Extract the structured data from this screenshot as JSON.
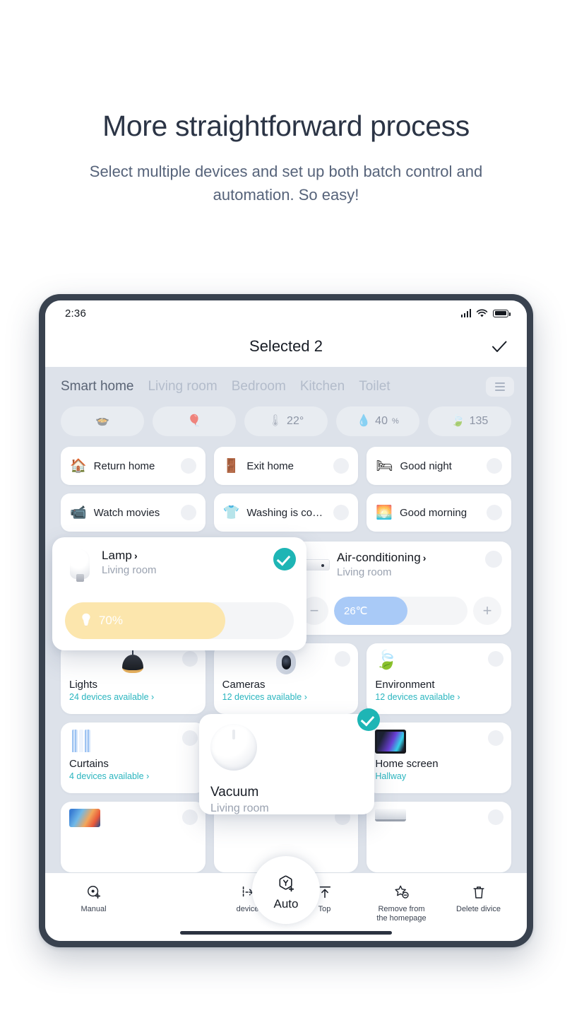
{
  "promo": {
    "title": "More straightforward process",
    "subtitle": "Select multiple devices and set up both batch control and automation. So easy!"
  },
  "status_bar": {
    "time": "2:36"
  },
  "nav": {
    "title": "Selected 2",
    "confirm_icon": "check-icon"
  },
  "room_tabs": [
    {
      "label": "Smart home",
      "active": true
    },
    {
      "label": "Living room",
      "active": false
    },
    {
      "label": "Bedroom",
      "active": false
    },
    {
      "label": "Kitchen",
      "active": false
    },
    {
      "label": "Toilet",
      "active": false
    }
  ],
  "sensor_chips": [
    {
      "icon": "cooking-pot-icon",
      "glyph": "🍲",
      "value": ""
    },
    {
      "icon": "balloon-icon",
      "glyph": "🎈",
      "value": ""
    },
    {
      "icon": "thermometer-icon",
      "glyph": "🌡",
      "value": "22°"
    },
    {
      "icon": "humidity-drop-icon",
      "glyph": "💧",
      "value": "40",
      "unit": "%"
    },
    {
      "icon": "leaf-icon",
      "glyph": "🍃",
      "value": "135"
    }
  ],
  "scenes": [
    {
      "label": "Return home",
      "icon": "house-icon",
      "glyph": "🏠"
    },
    {
      "label": "Exit home",
      "icon": "door-icon",
      "glyph": "🚪"
    },
    {
      "label": "Good night",
      "icon": "bed-icon",
      "glyph": "🛏"
    },
    {
      "label": "Watch movies",
      "icon": "video-camera-icon",
      "glyph": "📹"
    },
    {
      "label": "Washing is co…",
      "icon": "shirt-icon",
      "glyph": "👕"
    },
    {
      "label": "Good morning",
      "icon": "sunrise-icon",
      "glyph": "🌅"
    }
  ],
  "controls": {
    "lamp": {
      "name": "Lamp",
      "room": "Living room",
      "selected": true,
      "thumb_icon": "light-bulb-icon",
      "slider": {
        "icon": "brightness-bulb-icon",
        "value": "70%",
        "percent": 70,
        "fill_color": "#fce6ad"
      }
    },
    "air_conditioning": {
      "name": "Air-conditioning",
      "room": "Living room",
      "selected": false,
      "thumb_icon": "air-conditioner-icon",
      "stepper": {
        "minus": "−",
        "plus": "+",
        "value": "26℃",
        "percent": 55,
        "fill_color": "#a9caf7"
      }
    }
  },
  "categories": [
    {
      "name": "Lights",
      "sub": "24 devices available ›",
      "icon": "pendant-lamp-icon",
      "selected": false,
      "elevated": false
    },
    {
      "name": "Cameras",
      "sub": "12 devices available ›",
      "icon": "security-camera-icon",
      "selected": false,
      "elevated": false
    },
    {
      "name": "Environment",
      "sub": "12 devices available ›",
      "icon": "leaf-icon",
      "selected": false,
      "elevated": false
    },
    {
      "name": "Curtains",
      "sub": "4 devices available ›",
      "icon": "curtain-icon",
      "selected": false,
      "elevated": false
    },
    {
      "name": "Vacuum",
      "sub": "Living room",
      "icon": "robot-vacuum-icon",
      "selected": true,
      "elevated": true
    },
    {
      "name": "Home screen",
      "sub": "Hallway",
      "icon": "tv-screen-icon",
      "selected": false,
      "elevated": false
    }
  ],
  "toolbar": [
    {
      "label": "Manual",
      "icon": "manual-add-icon",
      "fab": false
    },
    {
      "label": "Auto",
      "icon": "auto-add-icon",
      "fab": true
    },
    {
      "label": "device",
      "icon": "move-device-icon",
      "fab": false
    },
    {
      "label": "Top",
      "icon": "pin-to-top-icon",
      "fab": false
    },
    {
      "label": "Remove from\nthe homepage",
      "icon": "remove-star-icon",
      "fab": false
    },
    {
      "label": "Delete divice",
      "icon": "trash-icon",
      "fab": false
    }
  ],
  "colors": {
    "accent_teal": "#1eb5b5",
    "link_teal": "#2ab5bf",
    "slider_yellow": "#fce6ad",
    "temp_blue": "#a9caf7",
    "app_bg": "#dde2ea",
    "bezel": "#39424f"
  }
}
